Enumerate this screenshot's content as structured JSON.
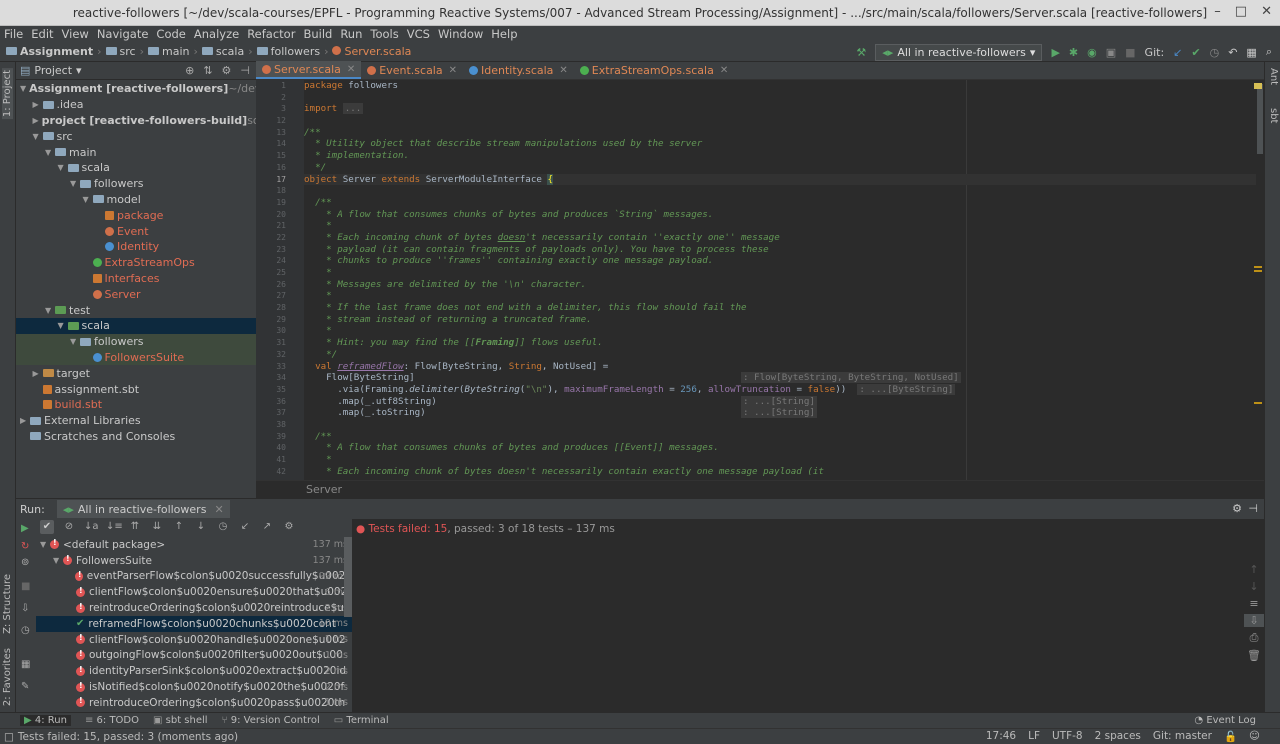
{
  "window": {
    "title": "reactive-followers [~/dev/scala-courses/EPFL - Programming Reactive Systems/007 - Advanced Stream Processing/Assignment] - .../src/main/scala/followers/Server.scala [reactive-followers]"
  },
  "menu": [
    "File",
    "Edit",
    "View",
    "Navigate",
    "Code",
    "Analyze",
    "Refactor",
    "Build",
    "Run",
    "Tools",
    "VCS",
    "Window",
    "Help"
  ],
  "breadcrumb": [
    "Assignment",
    "src",
    "main",
    "scala",
    "followers",
    "Server.scala"
  ],
  "run_config": "All in reactive-followers",
  "git_label": "Git:",
  "project_panel": {
    "title": "Project",
    "tree": [
      {
        "d": 0,
        "arrow": "▼",
        "icon": "fold",
        "text": "Assignment [reactive-followers]",
        "extra": " ~/dev/scala-",
        "bold": true
      },
      {
        "d": 1,
        "arrow": "▶",
        "icon": "fold",
        "text": ".idea"
      },
      {
        "d": 1,
        "arrow": "▶",
        "icon": "fold",
        "text": "project [reactive-followers-build]",
        "extra": " sources",
        "bold": true
      },
      {
        "d": 1,
        "arrow": "▼",
        "icon": "fold",
        "text": "src"
      },
      {
        "d": 2,
        "arrow": "▼",
        "icon": "fold",
        "text": "main"
      },
      {
        "d": 3,
        "arrow": "▼",
        "icon": "fold",
        "text": "scala"
      },
      {
        "d": 4,
        "arrow": "▼",
        "icon": "fold",
        "text": "followers"
      },
      {
        "d": 5,
        "arrow": "▼",
        "icon": "fold",
        "text": "model"
      },
      {
        "d": 6,
        "arrow": "",
        "icon": "pkg",
        "text": "package",
        "red": true
      },
      {
        "d": 6,
        "arrow": "",
        "icon": "obj",
        "text": "Event",
        "red": true
      },
      {
        "d": 6,
        "arrow": "",
        "icon": "cls",
        "text": "Identity",
        "red": true
      },
      {
        "d": 5,
        "arrow": "",
        "icon": "obj2",
        "text": "ExtraStreamOps",
        "red": true
      },
      {
        "d": 5,
        "arrow": "",
        "icon": "pkg",
        "text": "Interfaces",
        "red": true
      },
      {
        "d": 5,
        "arrow": "",
        "icon": "obj",
        "text": "Server",
        "red": true
      },
      {
        "d": 2,
        "arrow": "▼",
        "icon": "foldg",
        "text": "test"
      },
      {
        "d": 3,
        "arrow": "▼",
        "icon": "foldg",
        "text": "scala",
        "sel": true
      },
      {
        "d": 4,
        "arrow": "▼",
        "icon": "fold",
        "text": "followers",
        "hl": true
      },
      {
        "d": 5,
        "arrow": "",
        "icon": "cls",
        "text": "FollowersSuite",
        "red": true,
        "hl": true
      },
      {
        "d": 1,
        "arrow": "▶",
        "icon": "foldo",
        "text": "target"
      },
      {
        "d": 1,
        "arrow": "",
        "icon": "sbt",
        "text": "assignment.sbt"
      },
      {
        "d": 1,
        "arrow": "",
        "icon": "sbt",
        "text": "build.sbt",
        "red": true
      },
      {
        "d": 0,
        "arrow": "▶",
        "icon": "lib",
        "text": "External Libraries"
      },
      {
        "d": 0,
        "arrow": "",
        "icon": "scr",
        "text": "Scratches and Consoles"
      }
    ]
  },
  "editor": {
    "tabs": [
      {
        "label": "Server.scala",
        "active": true,
        "ic": "obj"
      },
      {
        "label": "Event.scala",
        "ic": "obj"
      },
      {
        "label": "Identity.scala",
        "ic": "cls"
      },
      {
        "label": "ExtraStreamOps.scala",
        "ic": "obj2"
      }
    ],
    "line_numbers": [
      "1",
      "2",
      "3",
      "12",
      "13",
      "14",
      "15",
      "16",
      "17",
      "18",
      "19",
      "20",
      "21",
      "22",
      "23",
      "24",
      "25",
      "26",
      "27",
      "28",
      "29",
      "30",
      "31",
      "32",
      "33",
      "34",
      "35",
      "36",
      "37",
      "38",
      "39",
      "40",
      "41",
      "42"
    ],
    "footer": "Server"
  },
  "run_panel": {
    "label": "Run:",
    "tab": "All in reactive-followers",
    "summary_failed": "Tests failed: 15",
    "summary_rest": ", passed: 3 of 18 tests – 137 ms",
    "tests": [
      {
        "d": 0,
        "status": "fail",
        "name": "<default package>",
        "ms": "137 ms"
      },
      {
        "d": 1,
        "status": "fail",
        "name": "FollowersSuite",
        "ms": "137 ms"
      },
      {
        "d": 2,
        "status": "fail",
        "name": "eventParserFlow$colon$u0020successfully$u0020",
        "ms": "99 ms"
      },
      {
        "d": 2,
        "status": "fail",
        "name": "clientFlow$colon$u0020ensure$u0020that$u002",
        "ms": "6 ms"
      },
      {
        "d": 2,
        "status": "fail",
        "name": "reintroduceOrdering$colon$u0020reintroduce$u",
        "ms": "2 ms"
      },
      {
        "d": 2,
        "status": "pass",
        "name": "reframedFlow$colon$u0020chunks$u0020cont",
        "ms": "10 ms",
        "sel": true
      },
      {
        "d": 2,
        "status": "fail",
        "name": "clientFlow$colon$u0020handle$u0020one$u002",
        "ms": "1 ms"
      },
      {
        "d": 2,
        "status": "fail",
        "name": "outgoingFlow$colon$u0020filter$u0020out$u00",
        "ms": "1 ms"
      },
      {
        "d": 2,
        "status": "fail",
        "name": "identityParserSink$colon$u0020extract$u0020id",
        "ms": "2 ms"
      },
      {
        "d": 2,
        "status": "fail",
        "name": "isNotified$colon$u0020notify$u0020the$u0020f",
        "ms": "2 ms"
      },
      {
        "d": 2,
        "status": "fail",
        "name": "reintroduceOrdering$colon$u0020pass$u0020th",
        "ms": "1 ms"
      }
    ]
  },
  "bottom_tabs": [
    "4: Run",
    "6: TODO",
    "sbt shell",
    "9: Version Control",
    "Terminal"
  ],
  "event_log": "Event Log",
  "left_tabs": [
    "1: Project",
    "Z: Structure",
    "2: Favorites"
  ],
  "right_tabs": [
    "Ant",
    "sbt"
  ],
  "status": {
    "message": "Tests failed: 15, passed: 3 (moments ago)",
    "position": "17:46",
    "line_sep": "LF",
    "encoding": "UTF-8",
    "indent": "2 spaces",
    "git": "Git: master"
  }
}
